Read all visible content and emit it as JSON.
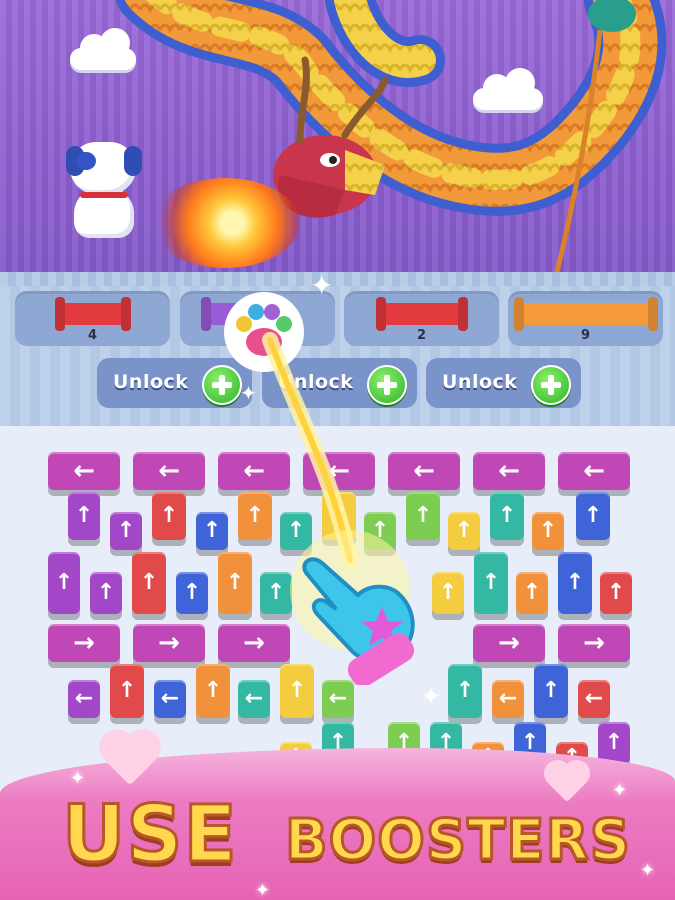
{
  "slots": [
    {
      "count": "4",
      "color": "#e23a3f"
    },
    {
      "count": "",
      "color": "#9a5bd6"
    },
    {
      "count": "2",
      "color": "#e23a3f"
    },
    {
      "count": "9",
      "color": "#f59a3a"
    }
  ],
  "unlock_buttons": [
    {
      "label": "Unlock"
    },
    {
      "label": "Unlock"
    },
    {
      "label": "Unlock"
    }
  ],
  "tile_colors": {
    "purple": "#a347c9",
    "magenta": "#c048b6",
    "red": "#e04a4a",
    "blue": "#3f64d8",
    "orange": "#f2913b",
    "teal": "#35b8a3",
    "green": "#7ccd52",
    "yellow": "#f3cd3f",
    "pink": "#f06ea8"
  },
  "banner": {
    "word1": "USE",
    "word2": "BOOSTERS"
  },
  "icons": {
    "booster": "knitted-paw-icon",
    "hand": "glove-pointer-icon"
  }
}
